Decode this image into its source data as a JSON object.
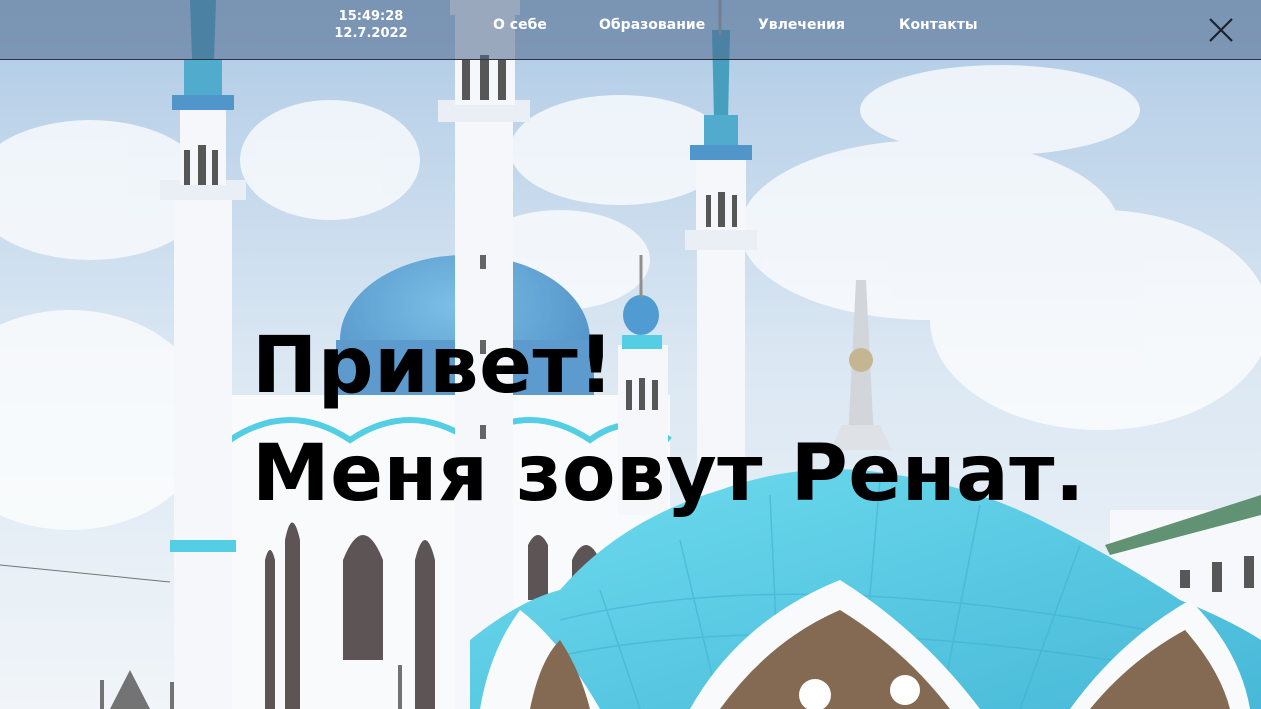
{
  "header": {
    "time": "15:49:28",
    "date": "12.7.2022",
    "nav": [
      {
        "label": "О себе"
      },
      {
        "label": "Образование"
      },
      {
        "label": "Увлечения"
      },
      {
        "label": "Контакты"
      }
    ],
    "close_icon": "close-icon"
  },
  "hero": {
    "line1": "Привет!",
    "line2": "Меня зовут Ренат.",
    "background": "mosque-photo"
  },
  "colors": {
    "header_bg": "#4e688c",
    "text_light": "#ffffff",
    "text_dark": "#000000",
    "dome": "#2ec4e0",
    "dome_dark": "#2a7fbf"
  }
}
